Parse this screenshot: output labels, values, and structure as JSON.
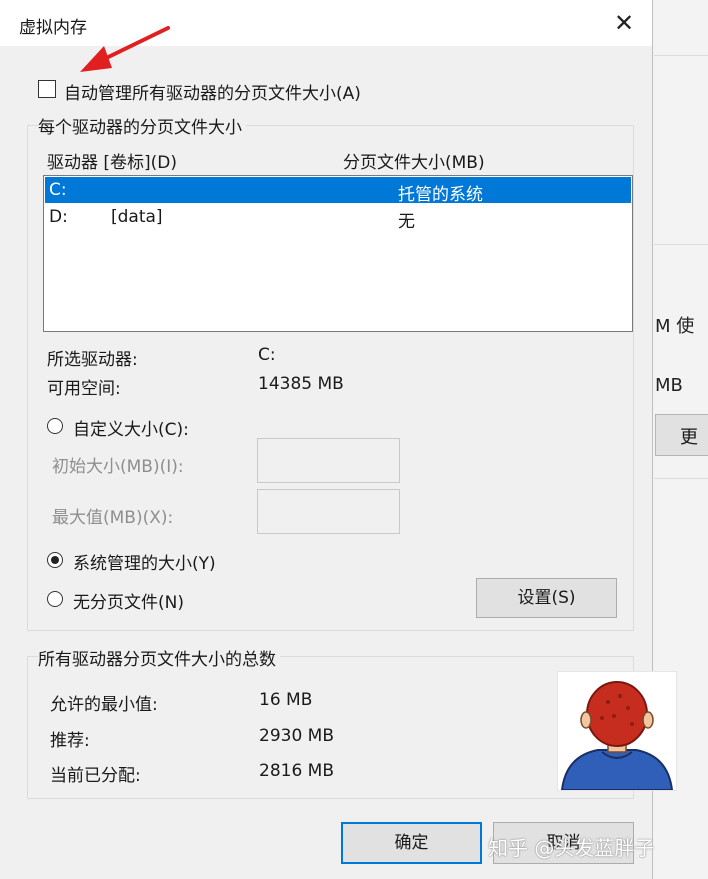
{
  "dialog": {
    "title": "虚拟内存",
    "close_glyph": "✕",
    "auto_manage_label": "自动管理所有驱动器的分页文件大小(A)",
    "auto_manage_checked": false,
    "per_drive": {
      "group_title": "每个驱动器的分页文件大小",
      "col_drive": "驱动器 [卷标](D)",
      "col_size": "分页文件大小(MB)",
      "drives": [
        {
          "drive": "C:",
          "label": "",
          "size": "托管的系统",
          "selected": true
        },
        {
          "drive": "D:",
          "label": "[data]",
          "size": "无",
          "selected": false
        }
      ],
      "selected_drive_label": "所选驱动器:",
      "selected_drive_value": "C:",
      "free_space_label": "可用空间:",
      "free_space_value": "14385 MB",
      "custom_size_label": "自定义大小(C):",
      "initial_size_label": "初始大小(MB)(I):",
      "max_size_label": "最大值(MB)(X):",
      "system_managed_label": "系统管理的大小(Y)",
      "no_paging_label": "无分页文件(N)",
      "selected_option": "system_managed",
      "set_button": "设置(S)"
    },
    "totals": {
      "group_title": "所有驱动器分页文件大小的总数",
      "min_label": "允许的最小值:",
      "min_value": "16 MB",
      "recommended_label": "推荐:",
      "recommended_value": "2930 MB",
      "current_label": "当前已分配:",
      "current_value": "2816 MB"
    },
    "ok_button": "确定",
    "cancel_button": "取消"
  },
  "background_window": {
    "text_1": "M 使",
    "text_2": "MB",
    "button_fragment": "更"
  },
  "watermark": "知乎 @头发蓝胖子",
  "colors": {
    "selection": "#0078d7",
    "annotation_arrow": "#e02020",
    "dialog_bg": "#f0f0f0"
  }
}
